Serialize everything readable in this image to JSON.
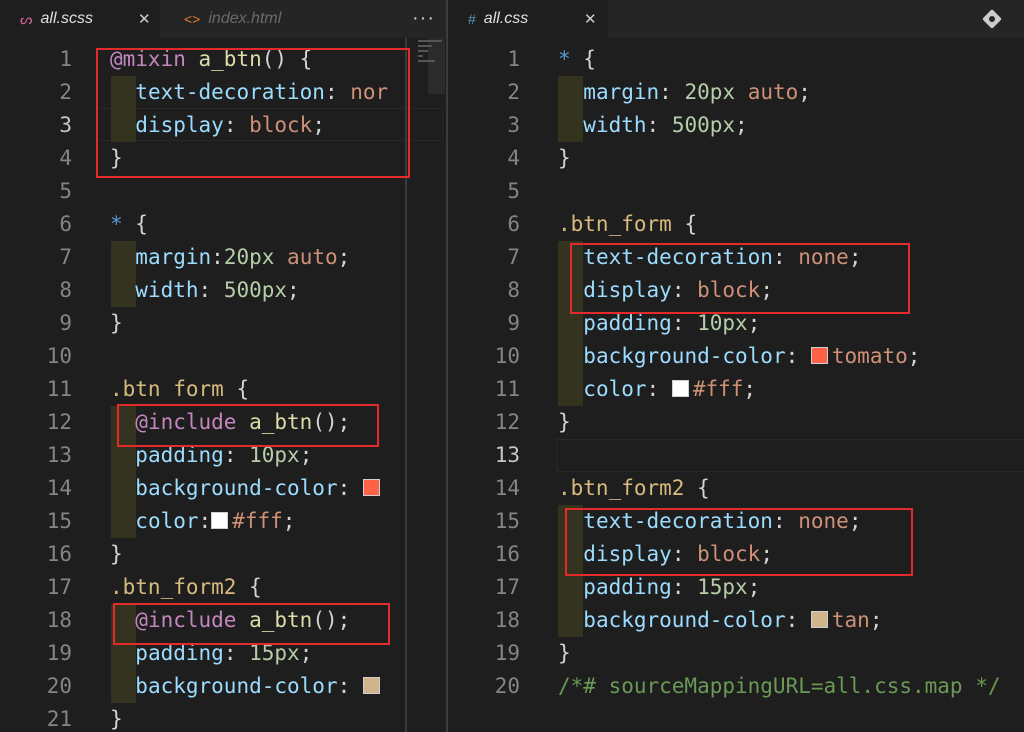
{
  "tabs": {
    "left": [
      {
        "label": "all.scss",
        "icon": "scss-file-icon",
        "active": true
      },
      {
        "label": "index.html",
        "icon": "html-file-icon",
        "active": false
      }
    ],
    "left_more": "···",
    "right": [
      {
        "label": "all.css",
        "icon": "css-file-icon",
        "active": true
      }
    ],
    "close_glyph": "✕"
  },
  "left_editor": {
    "file": "all.scss",
    "current_line": 3,
    "lines": [
      {
        "n": "1",
        "tokens": [
          [
            "at",
            "@mixin"
          ],
          [
            "p",
            " "
          ],
          [
            "fn",
            "a_btn"
          ],
          [
            "p",
            "() {"
          ]
        ]
      },
      {
        "n": "2",
        "tokens": [
          [
            "p",
            "  "
          ],
          [
            "prop",
            "text-decoration"
          ],
          [
            "p",
            ": "
          ],
          [
            "val",
            "nor"
          ]
        ]
      },
      {
        "n": "3",
        "tokens": [
          [
            "p",
            "  "
          ],
          [
            "prop",
            "display"
          ],
          [
            "p",
            ": "
          ],
          [
            "val",
            "block"
          ],
          [
            "p",
            ";"
          ]
        ]
      },
      {
        "n": "4",
        "tokens": [
          [
            "p",
            "}"
          ]
        ]
      },
      {
        "n": "5",
        "tokens": []
      },
      {
        "n": "6",
        "tokens": [
          [
            "star",
            "*"
          ],
          [
            "p",
            " {"
          ]
        ]
      },
      {
        "n": "7",
        "tokens": [
          [
            "p",
            "  "
          ],
          [
            "prop",
            "margin"
          ],
          [
            "p",
            ":"
          ],
          [
            "num",
            "20px"
          ],
          [
            "p",
            " "
          ],
          [
            "val",
            "auto"
          ],
          [
            "p",
            ";"
          ]
        ]
      },
      {
        "n": "8",
        "tokens": [
          [
            "p",
            "  "
          ],
          [
            "prop",
            "width"
          ],
          [
            "p",
            ": "
          ],
          [
            "num",
            "500px"
          ],
          [
            "p",
            ";"
          ]
        ]
      },
      {
        "n": "9",
        "tokens": [
          [
            "p",
            "}"
          ]
        ]
      },
      {
        "n": "10",
        "tokens": []
      },
      {
        "n": "11",
        "tokens": [
          [
            "sel",
            ".btn form"
          ],
          [
            "p",
            " {"
          ]
        ]
      },
      {
        "n": "12",
        "tokens": [
          [
            "p",
            "  "
          ],
          [
            "at",
            "@include"
          ],
          [
            "p",
            " "
          ],
          [
            "fn",
            "a_btn"
          ],
          [
            "p",
            "();"
          ]
        ]
      },
      {
        "n": "13",
        "tokens": [
          [
            "p",
            "  "
          ],
          [
            "prop",
            "padding"
          ],
          [
            "p",
            ": "
          ],
          [
            "num",
            "10px"
          ],
          [
            "p",
            ";"
          ]
        ]
      },
      {
        "n": "14",
        "tokens": [
          [
            "p",
            "  "
          ],
          [
            "prop",
            "background-color"
          ],
          [
            "p",
            ": "
          ],
          [
            "swatch",
            "#ff6347"
          ]
        ]
      },
      {
        "n": "15",
        "tokens": [
          [
            "p",
            "  "
          ],
          [
            "prop",
            "color"
          ],
          [
            "p",
            ":"
          ],
          [
            "swatch",
            "#ffffff"
          ],
          [
            "val",
            "#fff"
          ],
          [
            "p",
            ";"
          ]
        ]
      },
      {
        "n": "16",
        "tokens": [
          [
            "p",
            "}"
          ]
        ]
      },
      {
        "n": "17",
        "tokens": [
          [
            "sel",
            ".btn_form2"
          ],
          [
            "p",
            " {"
          ]
        ]
      },
      {
        "n": "18",
        "tokens": [
          [
            "p",
            "  "
          ],
          [
            "at",
            "@include"
          ],
          [
            "p",
            " "
          ],
          [
            "fn",
            "a_btn"
          ],
          [
            "p",
            "();"
          ]
        ]
      },
      {
        "n": "19",
        "tokens": [
          [
            "p",
            "  "
          ],
          [
            "prop",
            "padding"
          ],
          [
            "p",
            ": "
          ],
          [
            "num",
            "15px"
          ],
          [
            "p",
            ";"
          ]
        ]
      },
      {
        "n": "20",
        "tokens": [
          [
            "p",
            "  "
          ],
          [
            "prop",
            "background-color"
          ],
          [
            "p",
            ": "
          ],
          [
            "swatch",
            "#d2b48c"
          ]
        ]
      },
      {
        "n": "21",
        "tokens": [
          [
            "p",
            "}"
          ]
        ]
      }
    ]
  },
  "right_editor": {
    "file": "all.css",
    "current_line": 13,
    "lines": [
      {
        "n": "1",
        "tokens": [
          [
            "star",
            "*"
          ],
          [
            "p",
            " {"
          ]
        ]
      },
      {
        "n": "2",
        "tokens": [
          [
            "p",
            "  "
          ],
          [
            "prop",
            "margin"
          ],
          [
            "p",
            ": "
          ],
          [
            "num",
            "20px"
          ],
          [
            "p",
            " "
          ],
          [
            "val",
            "auto"
          ],
          [
            "p",
            ";"
          ]
        ]
      },
      {
        "n": "3",
        "tokens": [
          [
            "p",
            "  "
          ],
          [
            "prop",
            "width"
          ],
          [
            "p",
            ": "
          ],
          [
            "num",
            "500px"
          ],
          [
            "p",
            ";"
          ]
        ]
      },
      {
        "n": "4",
        "tokens": [
          [
            "p",
            "}"
          ]
        ]
      },
      {
        "n": "5",
        "tokens": []
      },
      {
        "n": "6",
        "tokens": [
          [
            "sel",
            ".btn_form"
          ],
          [
            "p",
            " {"
          ]
        ]
      },
      {
        "n": "7",
        "tokens": [
          [
            "p",
            "  "
          ],
          [
            "prop",
            "text-decoration"
          ],
          [
            "p",
            ": "
          ],
          [
            "val",
            "none"
          ],
          [
            "p",
            ";"
          ]
        ]
      },
      {
        "n": "8",
        "tokens": [
          [
            "p",
            "  "
          ],
          [
            "prop",
            "display"
          ],
          [
            "p",
            ": "
          ],
          [
            "val",
            "block"
          ],
          [
            "p",
            ";"
          ]
        ]
      },
      {
        "n": "9",
        "tokens": [
          [
            "p",
            "  "
          ],
          [
            "prop",
            "padding"
          ],
          [
            "p",
            ": "
          ],
          [
            "num",
            "10px"
          ],
          [
            "p",
            ";"
          ]
        ]
      },
      {
        "n": "10",
        "tokens": [
          [
            "p",
            "  "
          ],
          [
            "prop",
            "background-color"
          ],
          [
            "p",
            ": "
          ],
          [
            "swatch",
            "#ff6347"
          ],
          [
            "val",
            "tomato"
          ],
          [
            "p",
            ";"
          ]
        ]
      },
      {
        "n": "11",
        "tokens": [
          [
            "p",
            "  "
          ],
          [
            "prop",
            "color"
          ],
          [
            "p",
            ": "
          ],
          [
            "swatch",
            "#ffffff"
          ],
          [
            "val",
            "#fff"
          ],
          [
            "p",
            ";"
          ]
        ]
      },
      {
        "n": "12",
        "tokens": [
          [
            "p",
            "}"
          ]
        ]
      },
      {
        "n": "13",
        "tokens": []
      },
      {
        "n": "14",
        "tokens": [
          [
            "sel",
            ".btn_form2"
          ],
          [
            "p",
            " {"
          ]
        ]
      },
      {
        "n": "15",
        "tokens": [
          [
            "p",
            "  "
          ],
          [
            "prop",
            "text-decoration"
          ],
          [
            "p",
            ": "
          ],
          [
            "val",
            "none"
          ],
          [
            "p",
            ";"
          ]
        ]
      },
      {
        "n": "16",
        "tokens": [
          [
            "p",
            "  "
          ],
          [
            "prop",
            "display"
          ],
          [
            "p",
            ": "
          ],
          [
            "val",
            "block"
          ],
          [
            "p",
            ";"
          ]
        ]
      },
      {
        "n": "17",
        "tokens": [
          [
            "p",
            "  "
          ],
          [
            "prop",
            "padding"
          ],
          [
            "p",
            ": "
          ],
          [
            "num",
            "15px"
          ],
          [
            "p",
            ";"
          ]
        ]
      },
      {
        "n": "18",
        "tokens": [
          [
            "p",
            "  "
          ],
          [
            "prop",
            "background-color"
          ],
          [
            "p",
            ": "
          ],
          [
            "swatch",
            "#d2b48c"
          ],
          [
            "val",
            "tan"
          ],
          [
            "p",
            ";"
          ]
        ]
      },
      {
        "n": "19",
        "tokens": [
          [
            "p",
            "}"
          ]
        ]
      },
      {
        "n": "20",
        "tokens": [
          [
            "cm",
            "/*# sourceMappingURL=all.css.map */"
          ]
        ]
      }
    ]
  },
  "colors": {
    "highlight_box": "#e32b2b",
    "tomato": "#ff6347",
    "tan": "#d2b48c",
    "white": "#ffffff"
  }
}
